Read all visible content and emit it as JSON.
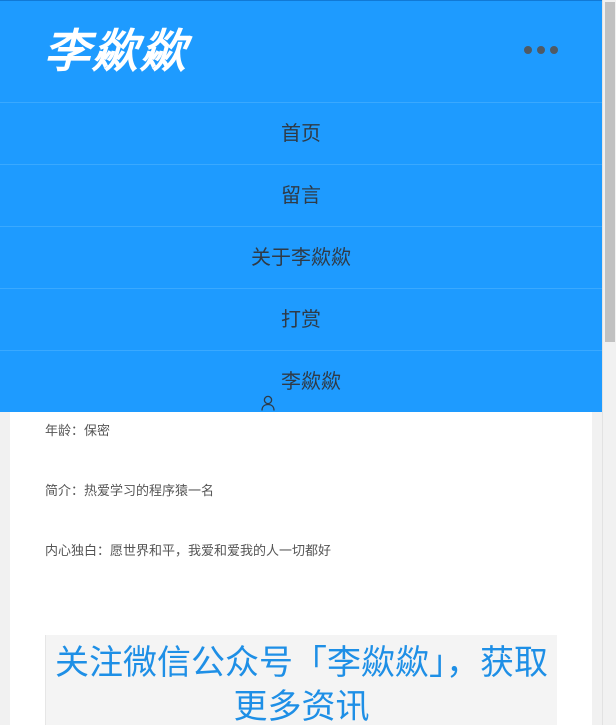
{
  "header": {
    "logo": "李歘歘",
    "more_icon": "ellipsis-icon"
  },
  "menu": {
    "items": [
      {
        "label": "首页"
      },
      {
        "label": "留言"
      },
      {
        "label": "关于李歘歘"
      },
      {
        "label": "打赏"
      },
      {
        "label": "李歘歘",
        "icon": "user-icon"
      }
    ]
  },
  "profile": {
    "age": "年龄：保密",
    "intro": "简介：热爱学习的程序猿一名",
    "monologue": "内心独白：愿世界和平，我爱和爱我的人一切都好"
  },
  "banner": {
    "text": "关注微信公众号「李歘歘」，获取更多资讯"
  },
  "colors": {
    "brand": "#1e9bff",
    "banner_text": "#1e8fe6"
  }
}
